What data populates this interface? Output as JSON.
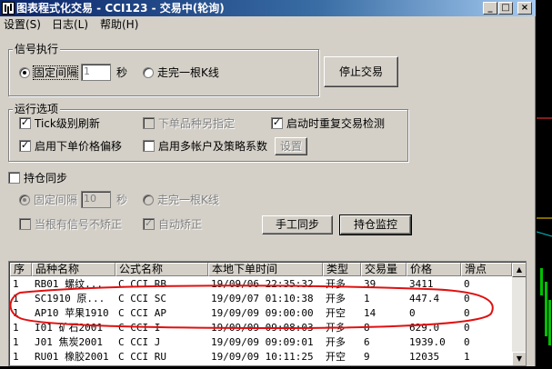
{
  "window": {
    "title": "图表程式化交易 - CCI123 - 交易中(轮询)",
    "controls": {
      "minimize": "_",
      "maximize": "□",
      "close": "×"
    }
  },
  "menu": [
    "设置(S)",
    "日志(L)",
    "帮助(H)"
  ],
  "signal_group": {
    "title": "信号执行",
    "fixed_interval_label": "固定间隔",
    "interval_value": "1",
    "unit": "秒",
    "bar_end_label": "走完一根K线",
    "selected": "fixed"
  },
  "stop_button": "停止交易",
  "run_options": {
    "title": "运行选项",
    "tick_refresh": {
      "label": "Tick级别刷新",
      "checked": true
    },
    "diff_symbol": {
      "label": "下单品种另指定",
      "checked": false,
      "disabled": true
    },
    "startup_check": {
      "label": "启动时重复交易检测",
      "checked": true
    },
    "price_offset": {
      "label": "启用下单价格偏移",
      "checked": true
    },
    "multi_account": {
      "label": "启用多帐户及策略系数",
      "checked": false
    },
    "settings_button": "设置"
  },
  "position_sync": {
    "label": "持仓同步",
    "checked": false,
    "fixed_interval_label": "固定间隔",
    "interval_value": "10",
    "unit": "秒",
    "bar_end_label": "走完一根K线",
    "no_signal_label": "当根有信号不矫正",
    "auto_correct_label": "自动矫正",
    "manual_sync_button": "手工同步",
    "position_monitor_button": "持仓监控"
  },
  "table": {
    "columns": [
      "序",
      "品种名称",
      "公式名称",
      "本地下单时间",
      "类型",
      "交易量",
      "价格",
      "滑点"
    ],
    "rows": [
      [
        "1",
        "RB01 螺纹...",
        "C CCI RB",
        "19/09/06 22:35:32",
        "开多",
        "39",
        "3411",
        "0"
      ],
      [
        "1",
        "SC1910 原...",
        "C CCI SC",
        "19/09/07 01:10:38",
        "开多",
        "1",
        "447.4",
        "0"
      ],
      [
        "1",
        "AP10 苹果1910",
        "C CCI AP",
        "19/09/09 09:00:00",
        "开空",
        "14",
        "0",
        "0"
      ],
      [
        "1",
        "I01 矿石2001",
        "C CCI I",
        "19/09/09 09:08:03",
        "开多",
        "8",
        "629.0",
        "0"
      ],
      [
        "1",
        "J01 焦炭2001",
        "C CCI J",
        "19/09/09 09:09:01",
        "开多",
        "6",
        "1939.0",
        "0"
      ],
      [
        "1",
        "RU01 橡胶2001",
        "C CCI RU",
        "19/09/09 10:11:25",
        "开空",
        "9",
        "12035",
        "1"
      ]
    ]
  },
  "annotation_color": "#e01010",
  "titlebar_color": "#0a246a"
}
